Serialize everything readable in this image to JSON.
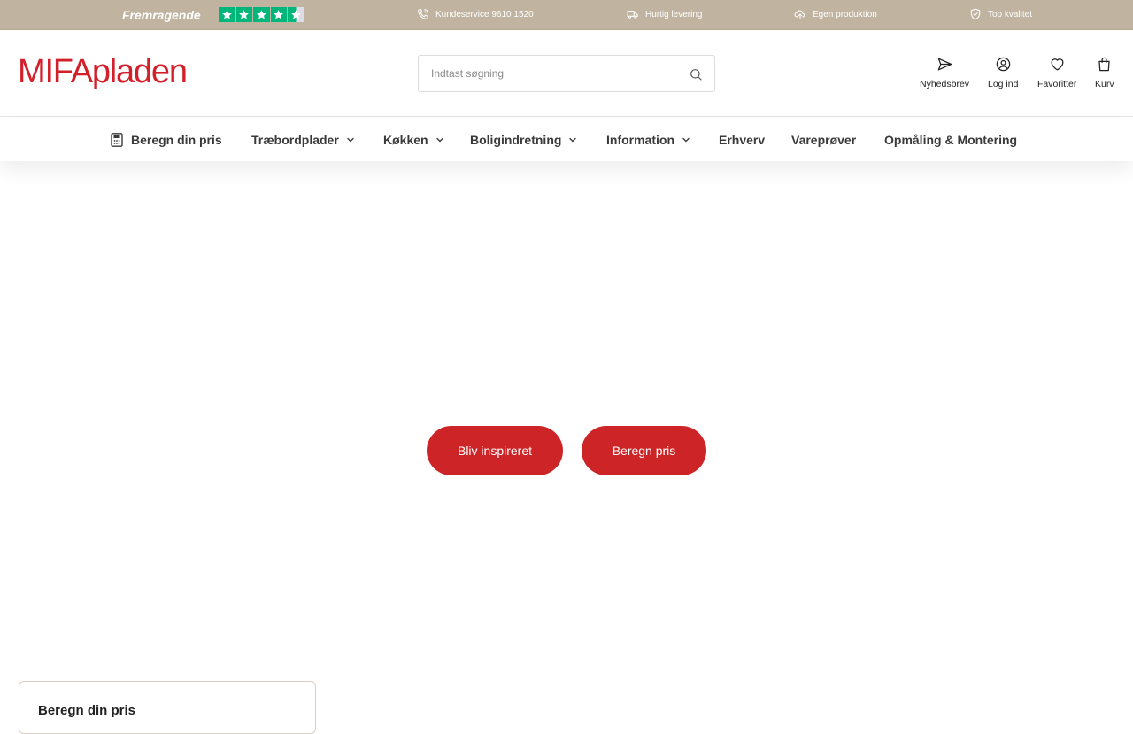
{
  "topbar": {
    "rating_text": "Fremragende",
    "stars": 4.5,
    "star_color": "#00b67a",
    "usps": [
      {
        "icon": "phone-icon",
        "label": "Kundeservice 9610 1520"
      },
      {
        "icon": "truck-icon",
        "label": "Hurtig levering"
      },
      {
        "icon": "cloud-upload-icon",
        "label": "Egen produktion"
      },
      {
        "icon": "shield-check-icon",
        "label": "Top kvalitet"
      }
    ],
    "background": "#c0b4a1"
  },
  "header": {
    "logo": "MIFApladen",
    "logo_color": "#d21f2a",
    "search": {
      "placeholder": "Indtast søgning",
      "value": ""
    },
    "actions": [
      {
        "icon": "send-icon",
        "label": "Nyhedsbrev"
      },
      {
        "icon": "user-icon",
        "label": "Log ind"
      },
      {
        "icon": "heart-icon",
        "label": "Favoritter"
      },
      {
        "icon": "bag-icon",
        "label": "Kurv"
      }
    ]
  },
  "nav": {
    "items": [
      {
        "label": "Beregn din pris",
        "icon": "calculator-icon",
        "dropdown": false
      },
      {
        "label": "Træbordplader",
        "dropdown": true
      },
      {
        "label": "Køkken",
        "dropdown": true
      },
      {
        "label": "Boligindretning",
        "dropdown": true
      },
      {
        "label": "Information",
        "dropdown": true
      },
      {
        "label": "Erhverv",
        "dropdown": false
      },
      {
        "label": "Vareprøver",
        "dropdown": false
      },
      {
        "label": "Opmåling & Montering",
        "dropdown": false
      }
    ]
  },
  "hero": {
    "buttons": [
      {
        "label": "Bliv inspireret"
      },
      {
        "label": "Beregn pris"
      }
    ],
    "button_color": "#cd2527"
  },
  "card": {
    "title": "Beregn din pris"
  }
}
